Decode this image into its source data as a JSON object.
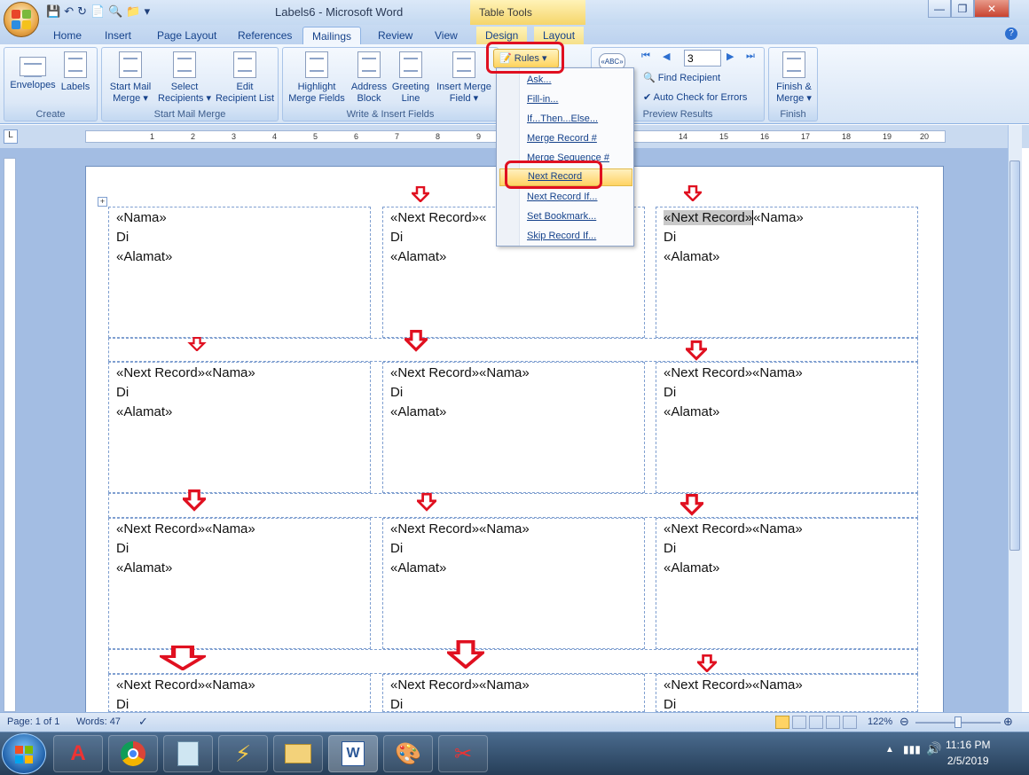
{
  "window": {
    "title": "Labels6 - Microsoft Word",
    "contextual_tab_group": "Table Tools"
  },
  "tabs": [
    "Home",
    "Insert",
    "Page Layout",
    "References",
    "Mailings",
    "Review",
    "View",
    "Design",
    "Layout"
  ],
  "ribbon": {
    "create": {
      "label": "Create",
      "envelopes": "Envelopes",
      "labels": "Labels"
    },
    "start_mail_merge": {
      "label": "Start Mail Merge",
      "start_l1": "Start Mail",
      "start_l2": "Merge",
      "select_l1": "Select",
      "select_l2": "Recipients",
      "edit_l1": "Edit",
      "edit_l2": "Recipient List"
    },
    "write_insert": {
      "label": "Write & Insert Fields",
      "highlight_l1": "Highlight",
      "highlight_l2": "Merge Fields",
      "address_l1": "Address",
      "address_l2": "Block",
      "greeting_l1": "Greeting",
      "greeting_l2": "Line",
      "insert_l1": "Insert Merge",
      "insert_l2": "Field",
      "rules": "Rules"
    },
    "preview": {
      "label": "Preview Results",
      "record_value": "3",
      "find_recipient": "Find Recipient",
      "auto_check": "Auto Check for Errors",
      "abc": "«ABC»"
    },
    "finish": {
      "label": "Finish",
      "finish_l1": "Finish &",
      "finish_l2": "Merge"
    }
  },
  "rules_menu": [
    "Ask...",
    "Fill-in...",
    "If...Then...Else...",
    "Merge Record #",
    "Merge Sequence #",
    "Next Record",
    "Next Record If...",
    "Set Bookmark...",
    "Skip Record If..."
  ],
  "ruler_numbers": [
    "1",
    "2",
    "3",
    "4",
    "5",
    "6",
    "7",
    "8",
    "9",
    "14",
    "15",
    "16",
    "17",
    "18",
    "19",
    "20"
  ],
  "labels": {
    "nama": "«Nama»",
    "next_nama": "«Next Record»«Nama»",
    "next_trunc": "«Next Record»«",
    "next": "«Next Record»",
    "di": "Di",
    "alamat": "«Alamat»"
  },
  "status": {
    "page": "Page: 1 of 1",
    "words": "Words: 47",
    "zoom": "122%"
  },
  "clock": {
    "time": "11:16 PM",
    "date": "2/5/2019"
  },
  "colors": {
    "annotation_red": "#e01020",
    "ribbon_blue": "#15428b",
    "menu_highlight": "#ffd364"
  }
}
